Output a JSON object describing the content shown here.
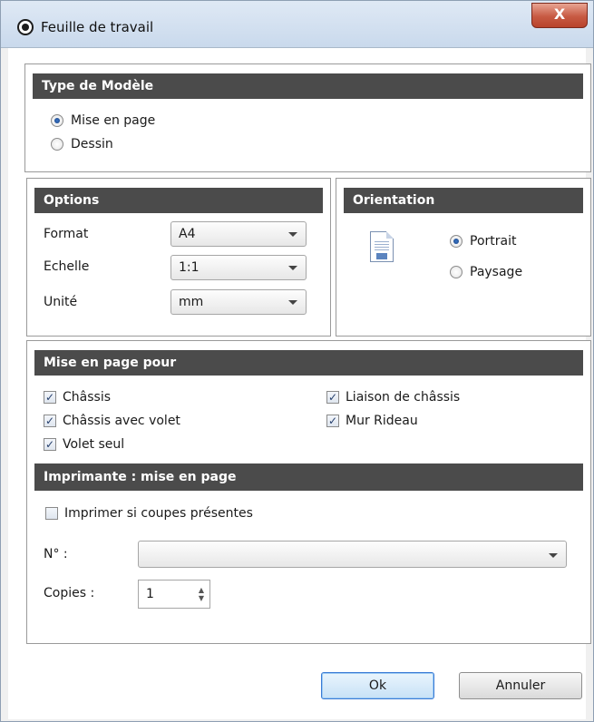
{
  "window": {
    "title": "Feuille de travail",
    "close_label": "X"
  },
  "type_modele": {
    "header": "Type de Modèle",
    "options": [
      {
        "label": "Mise en page",
        "selected": true
      },
      {
        "label": "Dessin",
        "selected": false
      }
    ]
  },
  "options": {
    "header": "Options",
    "rows": [
      {
        "label": "Format",
        "value": "A4"
      },
      {
        "label": "Echelle",
        "value": "1:1"
      },
      {
        "label": "Unité",
        "value": "mm"
      }
    ]
  },
  "orientation": {
    "header": "Orientation",
    "options": [
      {
        "label": "Portrait",
        "selected": true
      },
      {
        "label": "Paysage",
        "selected": false
      }
    ]
  },
  "mise_en_page_pour": {
    "header": "Mise en page pour",
    "items": [
      {
        "label": "Châssis",
        "checked": true
      },
      {
        "label": "Châssis avec volet",
        "checked": true
      },
      {
        "label": "Volet seul",
        "checked": true
      },
      {
        "label": "Liaison de châssis",
        "checked": true
      },
      {
        "label": "Mur Rideau",
        "checked": true
      }
    ]
  },
  "imprimante": {
    "header": "Imprimante : mise en page",
    "print_if_cuts": {
      "label": "Imprimer si coupes présentes",
      "checked": false
    },
    "numero": {
      "label": "N° :",
      "value": ""
    },
    "copies": {
      "label": "Copies :",
      "value": "1"
    }
  },
  "buttons": {
    "ok": "Ok",
    "cancel": "Annuler"
  },
  "colors": {
    "header_bg": "#4b4b4b",
    "close_red": "#c75a43",
    "accent": "#3a7bd5"
  }
}
